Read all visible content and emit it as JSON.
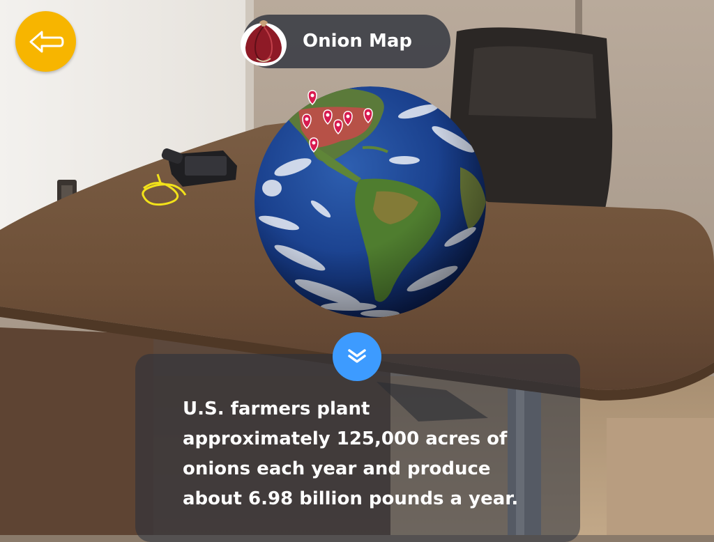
{
  "header": {
    "title": "Onion Map",
    "back_icon": "arrow-left-icon",
    "onion_icon": "red-onion-icon"
  },
  "fact": {
    "text": "U.S. farmers plant\napproximately 125,000 acres of\nonions each year and produce\nabout 6.98 billion pounds a year."
  },
  "controls": {
    "collapse_icon": "chevron-double-down-icon"
  },
  "colors": {
    "back_button": "#f7b500",
    "collapse_button": "#3d9bff",
    "map_pin": "#d81b50"
  }
}
